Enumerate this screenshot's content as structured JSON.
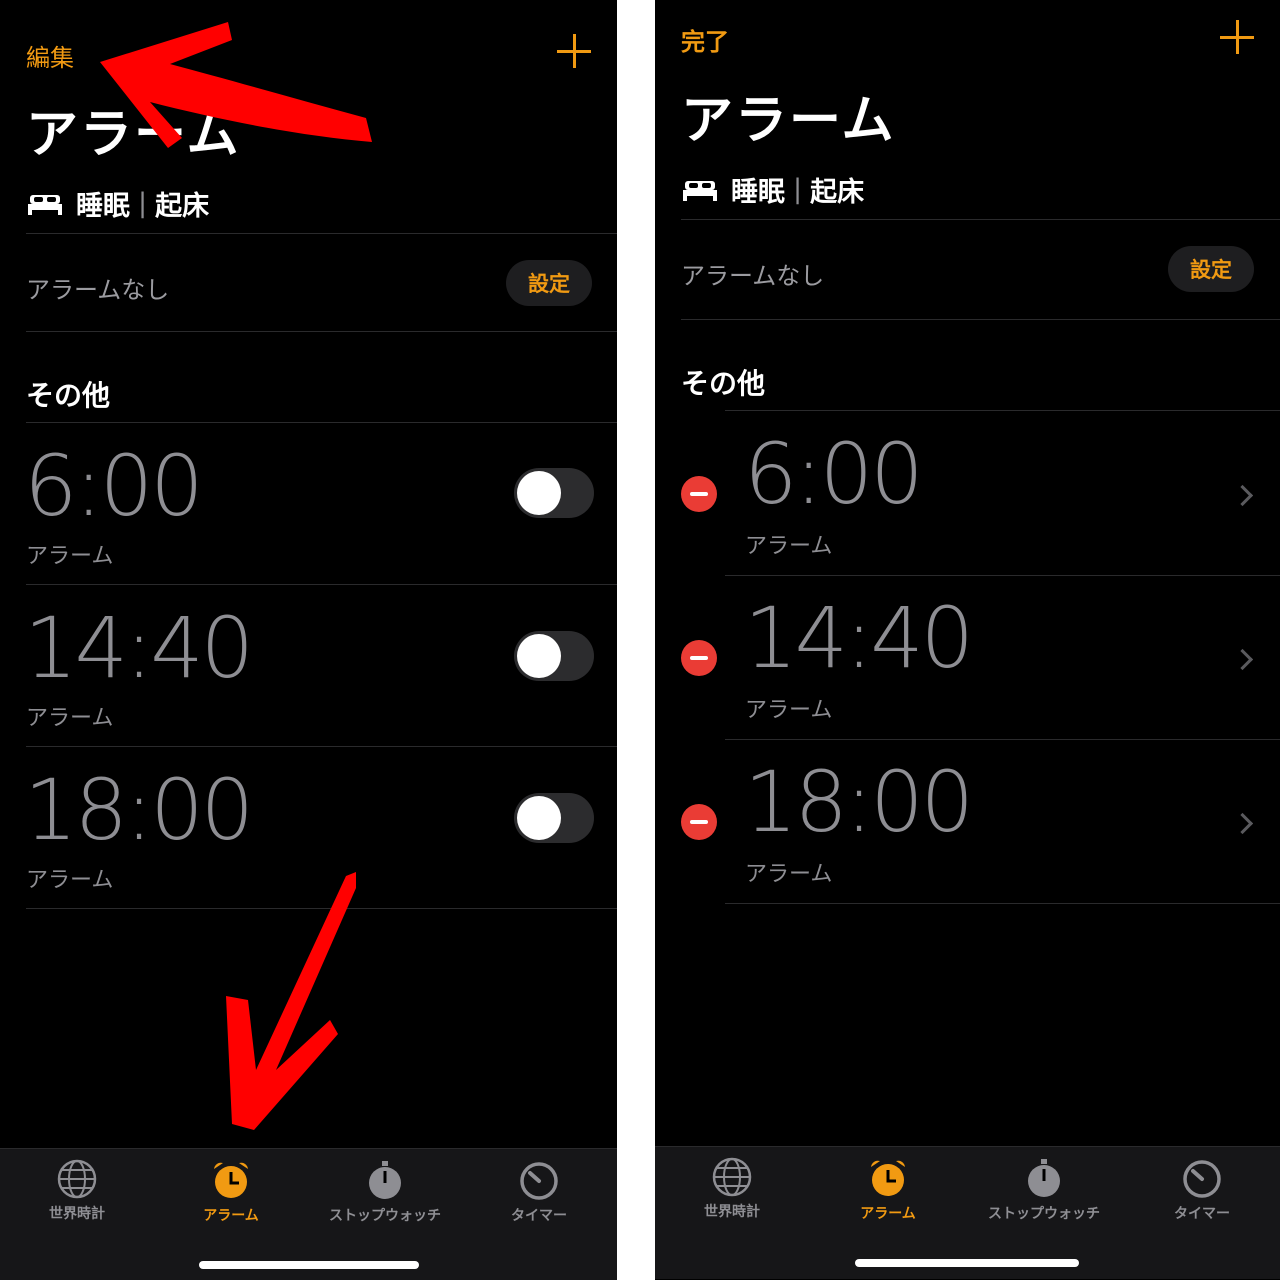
{
  "colors": {
    "accent": "#f19a12",
    "delete": "#ea3c35",
    "annotation": "#ff0000",
    "background": "#000000"
  },
  "left": {
    "edit_label": "編集",
    "title": "アラーム",
    "sleep_label": "睡眠",
    "wake_label": "起床",
    "sleep_separator": "|",
    "no_alarm": "アラームなし",
    "set_label": "設定",
    "section_title": "その他",
    "alarms": [
      {
        "time": "6:00",
        "label": "アラーム",
        "enabled": false
      },
      {
        "time": "14:40",
        "label": "アラーム",
        "enabled": false
      },
      {
        "time": "18:00",
        "label": "アラーム",
        "enabled": false
      }
    ]
  },
  "right": {
    "done_label": "完了",
    "title": "アラーム",
    "sleep_label": "睡眠",
    "wake_label": "起床",
    "sleep_separator": "|",
    "no_alarm": "アラームなし",
    "set_label": "設定",
    "section_title": "その他",
    "alarms": [
      {
        "time": "6:00",
        "label": "アラーム"
      },
      {
        "time": "14:40",
        "label": "アラーム"
      },
      {
        "time": "18:00",
        "label": "アラーム"
      }
    ]
  },
  "tabs": [
    {
      "label": "世界時計",
      "icon": "globe-icon",
      "active": false
    },
    {
      "label": "アラーム",
      "icon": "alarm-clock-icon",
      "active": true
    },
    {
      "label": "ストップウォッチ",
      "icon": "stopwatch-icon",
      "active": false
    },
    {
      "label": "タイマー",
      "icon": "timer-icon",
      "active": false
    }
  ]
}
